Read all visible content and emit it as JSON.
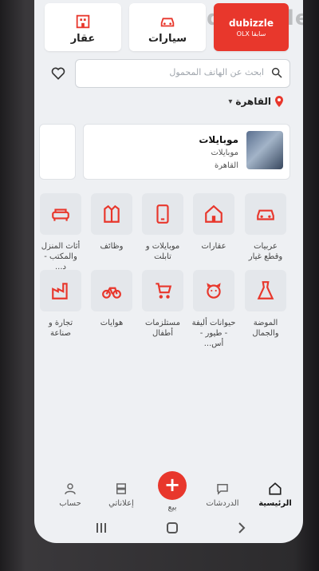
{
  "header": {
    "real_estate_label": "عقار",
    "cars_label": "سيارات",
    "brand_name": "dubizzle",
    "brand_sub": "OLX سابقا",
    "watermark": "dubizzle"
  },
  "search": {
    "placeholder": "ابحث عن الهاتف المحمول"
  },
  "location": {
    "city": "القاهرة"
  },
  "recent": {
    "title": "موبايلات",
    "subtitle": "موبايلات",
    "location": "القاهرة"
  },
  "categories": [
    {
      "label": "عربيات وقطع غيار",
      "icon": "car-icon"
    },
    {
      "label": "عقارات",
      "icon": "house-icon"
    },
    {
      "label": "موبايلات و تابلت",
      "icon": "mobile-icon"
    },
    {
      "label": "وظائف",
      "icon": "shirt-icon"
    },
    {
      "label": "أثاث المنزل والمكتب - د...",
      "icon": "sofa-icon"
    },
    {
      "label": "الموضة والجمال",
      "icon": "dress-icon"
    },
    {
      "label": "حيوانات أليفة - طيور - أس...",
      "icon": "pet-icon"
    },
    {
      "label": "مستلزمات أطفال",
      "icon": "stroller-icon"
    },
    {
      "label": "هوايات",
      "icon": "bicycle-icon"
    },
    {
      "label": "تجارة و صناعة",
      "icon": "factory-icon"
    }
  ],
  "nav": {
    "home": "الرئيسية",
    "chats": "الدردشات",
    "sell": "بيع",
    "my_ads": "إعلاناتي",
    "account": "حساب",
    "sell_symbol": "+"
  },
  "colors": {
    "accent": "#e8372c",
    "tile": "#e4e7eb"
  }
}
